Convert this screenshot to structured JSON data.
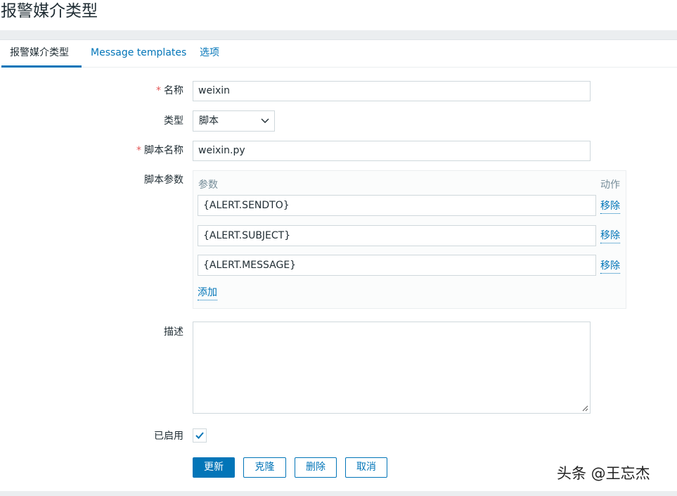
{
  "page": {
    "title": "报警媒介类型"
  },
  "tabs": [
    {
      "label": "报警媒介类型",
      "active": true
    },
    {
      "label": "Message templates",
      "active": false
    },
    {
      "label": "选项",
      "active": false
    }
  ],
  "form": {
    "name": {
      "label": "名称",
      "required": true,
      "value": "weixin"
    },
    "type": {
      "label": "类型",
      "value": "脚本"
    },
    "script_name": {
      "label": "脚本名称",
      "required": true,
      "value": "weixin.py"
    },
    "script_params": {
      "label": "脚本参数",
      "header_param": "参数",
      "header_action": "动作",
      "rows": [
        {
          "value": "{ALERT.SENDTO}",
          "remove_label": "移除"
        },
        {
          "value": "{ALERT.SUBJECT}",
          "remove_label": "移除"
        },
        {
          "value": "{ALERT.MESSAGE}",
          "remove_label": "移除"
        }
      ],
      "add_label": "添加"
    },
    "description": {
      "label": "描述",
      "value": ""
    },
    "enabled": {
      "label": "已启用",
      "checked": true
    }
  },
  "buttons": {
    "update": "更新",
    "clone": "克隆",
    "delete": "删除",
    "cancel": "取消"
  },
  "watermark": {
    "text": "头条 @王忘杰"
  },
  "colors": {
    "accent": "#0275b8",
    "required": "#e45959",
    "text": "#1f2c33"
  }
}
